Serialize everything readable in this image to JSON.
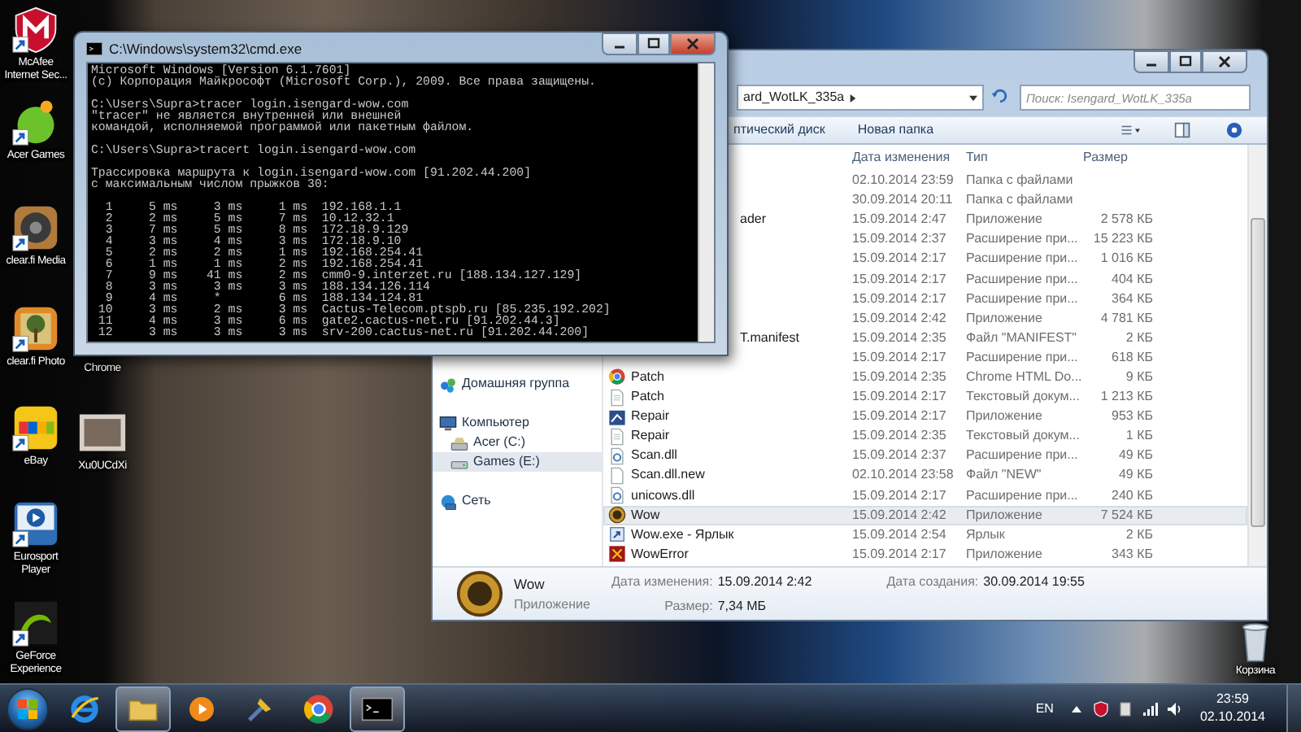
{
  "desktop_icons": [
    {
      "label": "McAfee Internet Sec...",
      "kind": "shield"
    },
    {
      "label": "Acer Games",
      "kind": "ball"
    },
    {
      "label": "clear.fi Media",
      "kind": "speaker"
    },
    {
      "label": "clear.fi Photo",
      "kind": "picture"
    },
    {
      "label": "eBay",
      "kind": "tiles"
    },
    {
      "label": "Eurosport Player",
      "kind": "play"
    },
    {
      "label": "GeForce Experience",
      "kind": "wave"
    }
  ],
  "desktop_icons_2": [
    {
      "label": "Chrome"
    },
    {
      "label": "Xu0UCdXi",
      "kind": "photo"
    }
  ],
  "recycle_bin": {
    "label": "Корзина"
  },
  "explorer": {
    "address": "ard_WotLK_335a",
    "search": {
      "placeholder": "Поиск: Isengard_WotLK_335a"
    },
    "toolbar": [
      "птический диск",
      "Новая папка"
    ],
    "nav": [
      {
        "label": "Домашняя группа",
        "kind": "homegroup",
        "selected": false
      },
      {
        "label": "Компьютер",
        "kind": "computer",
        "selected": false,
        "children": [
          {
            "label": "Acer (C:)",
            "kind": "drive",
            "selected": false
          },
          {
            "label": "Games (E:)",
            "kind": "drive2",
            "selected": true
          }
        ]
      },
      {
        "label": "Сеть",
        "kind": "network",
        "selected": false
      }
    ],
    "columns": [
      "Дата изменения",
      "Тип",
      "Размер"
    ],
    "rows": [
      {
        "date": "02.10.2014 23:59",
        "type": "Папка с файлами",
        "selected": false
      },
      {
        "date": "30.09.2014 20:11",
        "type": "Папка с файлами",
        "selected": false
      },
      {
        "name": "ader",
        "date": "15.09.2014 2:47",
        "type": "Приложение",
        "size": "2 578 КБ",
        "selected": false
      },
      {
        "date": "15.09.2014 2:37",
        "type": "Расширение при...",
        "size": "15 223 КБ",
        "selected": false
      },
      {
        "date": "15.09.2014 2:17",
        "type": "Расширение при...",
        "size": "1 016 КБ",
        "selected": false
      },
      {
        "date": "15.09.2014 2:17",
        "type": "Расширение при...",
        "size": "404 КБ",
        "selected": false
      },
      {
        "date": "15.09.2014 2:17",
        "type": "Расширение при...",
        "size": "364 КБ",
        "selected": false
      },
      {
        "date": "15.09.2014 2:42",
        "type": "Приложение",
        "size": "4 781 КБ",
        "selected": false
      },
      {
        "name": "T.manifest",
        "date": "15.09.2014 2:35",
        "type": "Файл \"MANIFEST\"",
        "size": "2 КБ",
        "selected": false
      },
      {
        "date": "15.09.2014 2:17",
        "type": "Расширение при...",
        "size": "618 КБ",
        "selected": false
      },
      {
        "name": "Patch",
        "kind": "roundlogo",
        "date": "15.09.2014 2:35",
        "type": "Chrome HTML Do...",
        "size": "9 КБ",
        "selected": false
      },
      {
        "name": "Patch",
        "kind": "page",
        "date": "15.09.2014 2:17",
        "type": "Текстовый докум...",
        "size": "1 213 КБ",
        "selected": false
      },
      {
        "name": "Repair",
        "kind": "appblue",
        "date": "15.09.2014 2:17",
        "type": "Приложение",
        "size": "953 КБ",
        "selected": false
      },
      {
        "name": "Repair",
        "kind": "page",
        "date": "15.09.2014 2:35",
        "type": "Текстовый докум...",
        "size": "1 КБ",
        "selected": false
      },
      {
        "name": "Scan.dll",
        "kind": "gearpage",
        "date": "15.09.2014 2:37",
        "type": "Расширение при...",
        "size": "49 КБ",
        "selected": false
      },
      {
        "name": "Scan.dll.new",
        "kind": "blank",
        "date": "02.10.2014 23:58",
        "type": "Файл \"NEW\"",
        "size": "49 КБ",
        "selected": false
      },
      {
        "name": "unicows.dll",
        "kind": "gearpage",
        "date": "15.09.2014 2:17",
        "type": "Расширение при...",
        "size": "240 КБ",
        "selected": false
      },
      {
        "name": "Wow",
        "kind": "emblem",
        "date": "15.09.2014 2:42",
        "type": "Приложение",
        "size": "7 524 КБ",
        "selected": true
      },
      {
        "name": "Wow.exe - Ярлык",
        "kind": "shortcut",
        "date": "15.09.2014 2:54",
        "type": "Ярлык",
        "size": "2 КБ",
        "selected": false
      },
      {
        "name": "WowError",
        "kind": "appred",
        "date": "15.09.2014 2:17",
        "type": "Приложение",
        "size": "343 КБ",
        "selected": false
      }
    ],
    "details": {
      "name": "Wow",
      "type": "Приложение",
      "fields": [
        {
          "label": "Дата изменения:",
          "value": "15.09.2014 2:42"
        },
        {
          "label": "Размер:",
          "value": "7,34 МБ"
        },
        {
          "label": "Дата создания:",
          "value": "30.09.2014 19:55"
        }
      ]
    }
  },
  "cmd": {
    "title": "C:\\Windows\\system32\\cmd.exe",
    "blocks": [
      [
        "Microsoft Windows [Version 6.1.7601]",
        "(c) Корпорация Майкрософт (Microsoft Corp.), 2009. Все права защищены."
      ],
      [
        "C:\\Users\\Supra>tracer login.isengard-wow.com",
        "\"tracer\" не является внутренней или внешней",
        "командой, исполняемой программой или пакетным файлом."
      ],
      [
        "C:\\Users\\Supra>tracert login.isengard-wow.com"
      ],
      [
        "Трассировка маршрута к login.isengard-wow.com [91.202.44.200]",
        "с максимальным числом прыжков 30:"
      ],
      [
        "  1     5 ms     3 ms     1 ms  192.168.1.1",
        "  2     2 ms     5 ms     7 ms  10.12.32.1",
        "  3     7 ms     5 ms     8 ms  172.18.9.129",
        "  4     3 ms     4 ms     3 ms  172.18.9.10",
        "  5     2 ms     2 ms     1 ms  192.168.254.41",
        "  6     1 ms     1 ms     2 ms  192.168.254.41",
        "  7     9 ms    41 ms     2 ms  cmm0-9.interzet.ru [188.134.127.129]",
        "  8     3 ms     3 ms     3 ms  188.134.126.114",
        "  9     4 ms     *        6 ms  188.134.124.81",
        " 10     3 ms     2 ms     3 ms  Cactus-Telecom.ptspb.ru [85.235.192.202]",
        " 11     4 ms     3 ms     6 ms  gate2.cactus-net.ru [91.202.44.3]",
        " 12     3 ms     3 ms     3 ms  srv-200.cactus-net.ru [91.202.44.200]"
      ]
    ]
  },
  "taskbar": {
    "apps": [
      {
        "kind": "ie",
        "active": false
      },
      {
        "kind": "folder",
        "active": true
      },
      {
        "kind": "media",
        "active": false
      },
      {
        "kind": "tool",
        "active": false
      },
      {
        "kind": "roundlogo",
        "active": false
      },
      {
        "kind": "terminal",
        "active": true
      }
    ],
    "language": "EN",
    "time": "23:59",
    "date": "02.10.2014"
  }
}
